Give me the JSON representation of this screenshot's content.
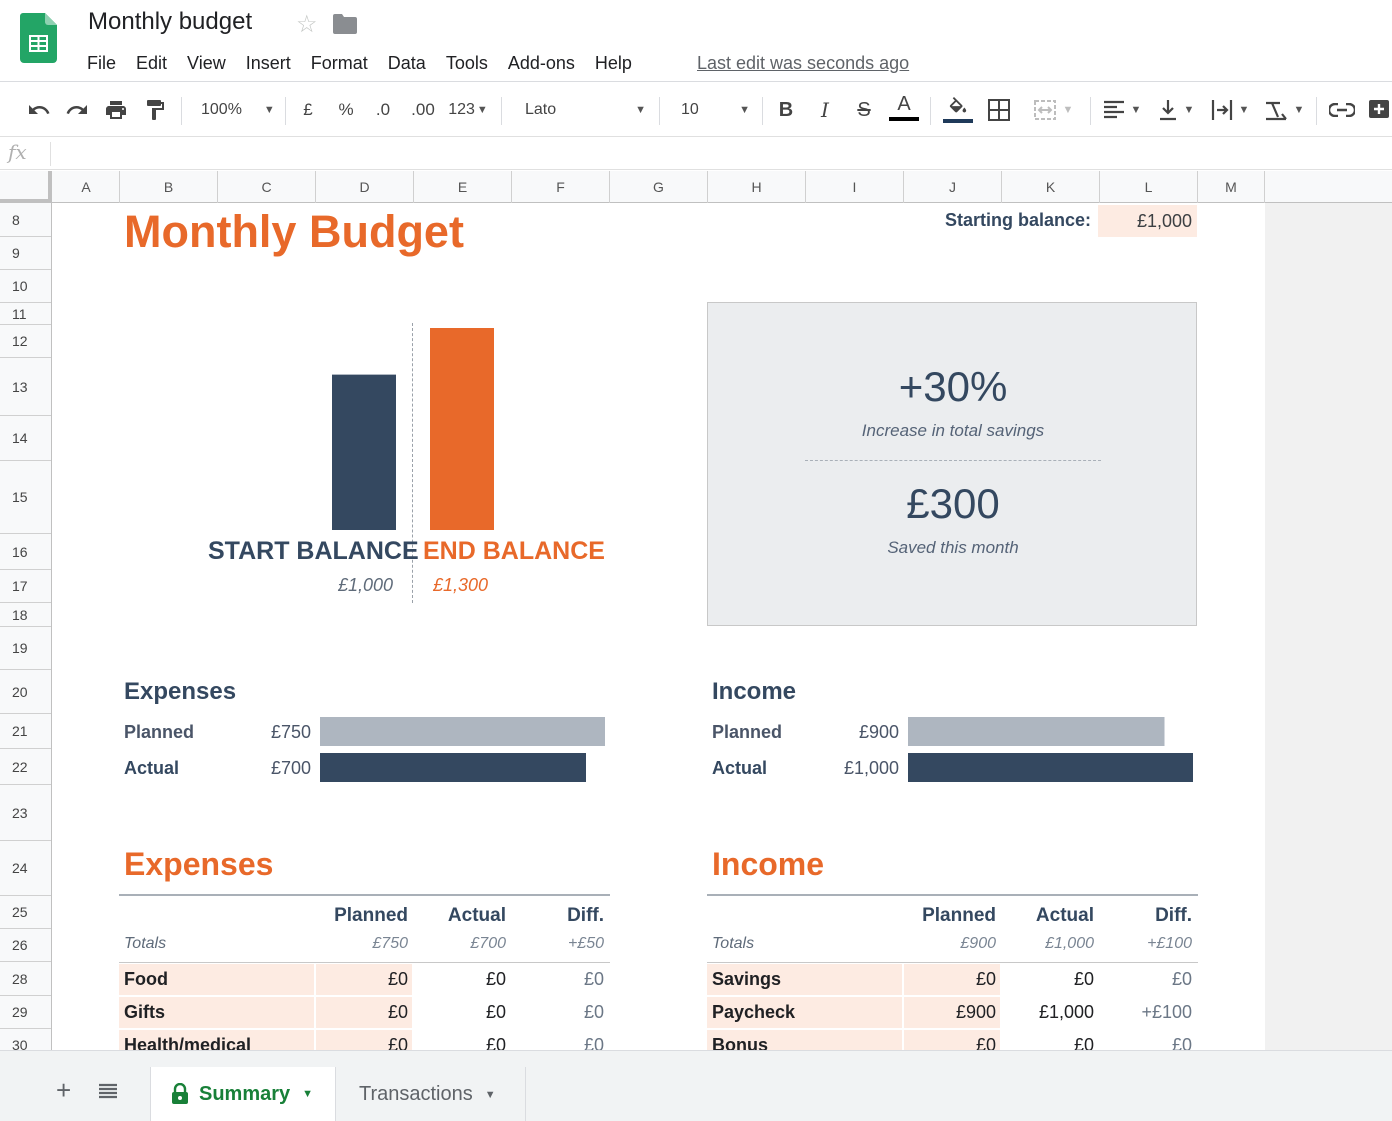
{
  "app": {
    "doc_title": "Monthly budget",
    "menu": [
      "File",
      "Edit",
      "View",
      "Insert",
      "Format",
      "Data",
      "Tools",
      "Add-ons",
      "Help"
    ],
    "last_edit": "Last edit was seconds ago"
  },
  "toolbar": {
    "zoom": "100%",
    "currency": "£",
    "percent": "%",
    "decrease_decimal": ".0",
    "increase_decimal": ".00",
    "more_formats": "123",
    "font": "Lato",
    "font_size": "10",
    "bold": "B",
    "italic": "I",
    "strike": "S",
    "text_color": "A"
  },
  "formula_bar": {
    "fx": "fx"
  },
  "columns": [
    "A",
    "B",
    "C",
    "D",
    "E",
    "F",
    "G",
    "H",
    "I",
    "J",
    "K",
    "L",
    "M"
  ],
  "rows": [
    "8",
    "9",
    "10",
    "11",
    "12",
    "13",
    "14",
    "15",
    "16",
    "17",
    "18",
    "19",
    "20",
    "21",
    "22",
    "23",
    "24",
    "25",
    "26",
    "28",
    "29",
    "30"
  ],
  "sheet": {
    "title": "Monthly Budget",
    "starting_balance_label": "Starting balance:",
    "starting_balance_value": "£1,000",
    "start_label": "START BALANCE",
    "end_label": "END BALANCE",
    "start_value": "£1,000",
    "end_value": "£1,300",
    "savings_pct": "+30%",
    "savings_pct_caption": "Increase in total savings",
    "saved_amount": "£300",
    "saved_caption": "Saved this month",
    "expenses_bars": {
      "title": "Expenses",
      "planned_label": "Planned",
      "planned_value": "£750",
      "actual_label": "Actual",
      "actual_value": "£700"
    },
    "income_bars": {
      "title": "Income",
      "planned_label": "Planned",
      "planned_value": "£900",
      "actual_label": "Actual",
      "actual_value": "£1,000"
    },
    "expenses_table": {
      "title": "Expenses",
      "headers": [
        "Planned",
        "Actual",
        "Diff."
      ],
      "totals_label": "Totals",
      "totals": [
        "£750",
        "£700",
        "+£50"
      ],
      "rows": [
        {
          "name": "Food",
          "planned": "£0",
          "actual": "£0",
          "diff": "£0"
        },
        {
          "name": "Gifts",
          "planned": "£0",
          "actual": "£0",
          "diff": "£0"
        },
        {
          "name": "Health/medical",
          "planned": "£0",
          "actual": "£0",
          "diff": "£0"
        }
      ]
    },
    "income_table": {
      "title": "Income",
      "headers": [
        "Planned",
        "Actual",
        "Diff."
      ],
      "totals_label": "Totals",
      "totals": [
        "£900",
        "£1,000",
        "+£100"
      ],
      "rows": [
        {
          "name": "Savings",
          "planned": "£0",
          "actual": "£0",
          "diff": "£0"
        },
        {
          "name": "Paycheck",
          "planned": "£900",
          "actual": "£1,000",
          "diff": "+£100"
        },
        {
          "name": "Bonus",
          "planned": "£0",
          "actual": "£0",
          "diff": "£0"
        }
      ]
    }
  },
  "tabs": {
    "summary": "Summary",
    "transactions": "Transactions"
  },
  "colors": {
    "accent_orange": "#e8692a",
    "navy": "#344860",
    "planned_gray": "#aeb6c0",
    "sheets_green": "#188038"
  },
  "chart_data": [
    {
      "type": "bar",
      "categories": [
        "START BALANCE",
        "END BALANCE"
      ],
      "values": [
        1000,
        1300
      ],
      "ylim": [
        0,
        1300
      ]
    },
    {
      "type": "bar",
      "categories": [
        "Planned",
        "Actual"
      ],
      "values": [
        750,
        700
      ],
      "title": "Expenses",
      "xlim": [
        0,
        750
      ]
    },
    {
      "type": "bar",
      "categories": [
        "Planned",
        "Actual"
      ],
      "values": [
        900,
        1000
      ],
      "title": "Income",
      "xlim": [
        0,
        1000
      ]
    }
  ]
}
